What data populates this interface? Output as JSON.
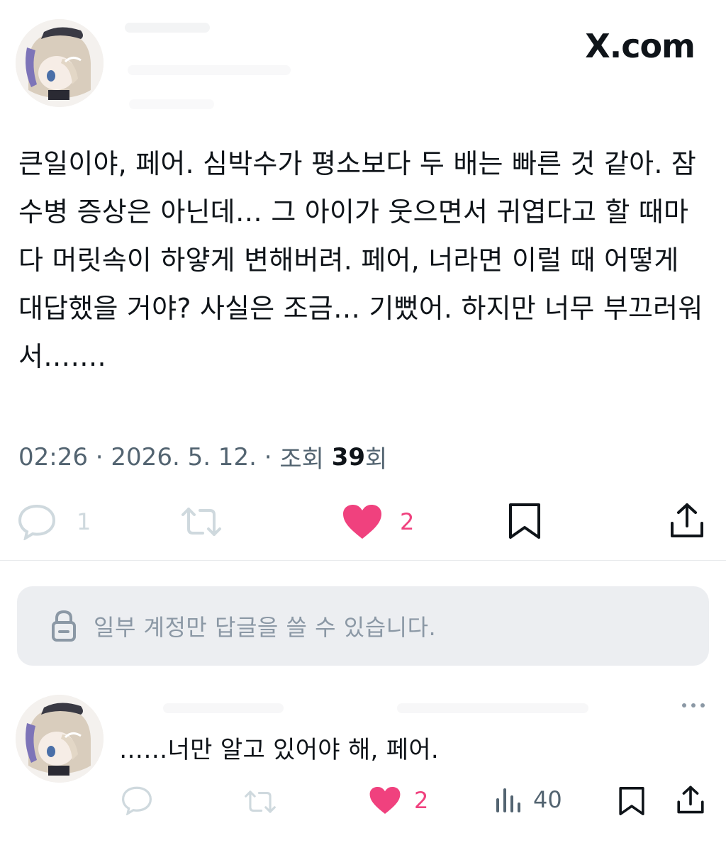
{
  "header": {
    "brand_label": "X.com"
  },
  "tweet": {
    "text": "큰일이야, 페어. 심박수가 평소보다 두 배는 빠른 것 같아. 잠수병 증상은 아닌데… 그 아이가 웃으면서 귀엽다고 할 때마다 머릿속이 하얗게 변해버려. 페어, 너라면 이럴 때 어떻게 대답했을 거야? 사실은 조금… 기뻤어. 하지만 너무 부끄러워서…….",
    "time": "02:26",
    "sep1": " · ",
    "date": "2026. 5. 12.",
    "sep2": " · ",
    "views_prefix": "조회 ",
    "views_count": "39",
    "views_suffix": "회",
    "actions": {
      "reply_count": "1",
      "like_count": "2"
    }
  },
  "reply_restriction": {
    "text": "일부 계정만 답글을 쓸 수 있습니다."
  },
  "reply": {
    "text": "……너만 알고 있어야 해, 페어.",
    "actions": {
      "like_count": "2",
      "views_count": "40"
    }
  },
  "colors": {
    "like": "#f0417e",
    "icon_muted": "#cfd9de",
    "icon_dark": "#0f1419",
    "meta_text": "#536471"
  }
}
